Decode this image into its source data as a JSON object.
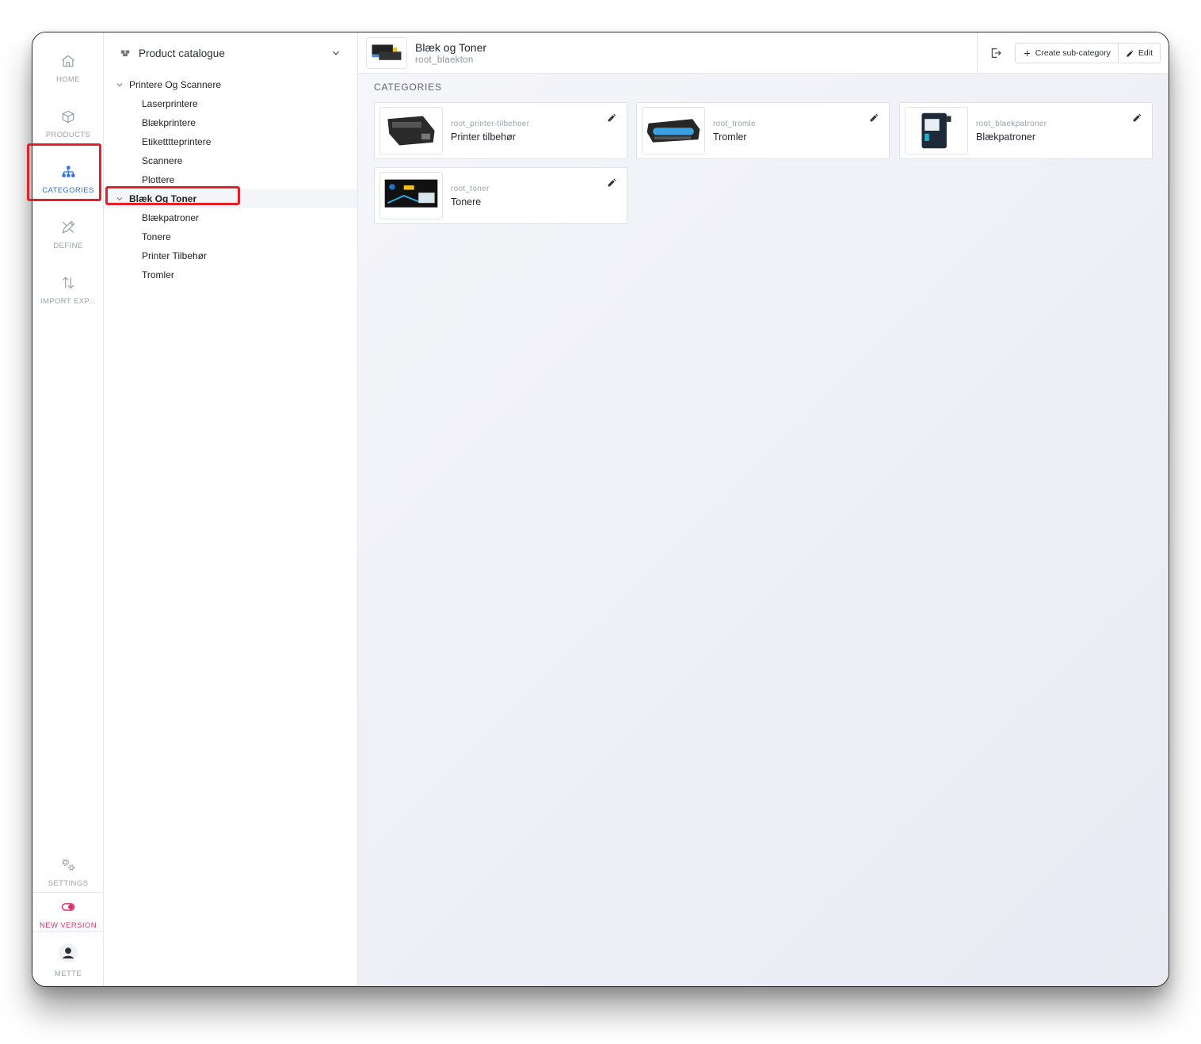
{
  "nav": {
    "home": "HOME",
    "products": "PRODUCTS",
    "categories": "CATEGORIES",
    "define": "DEFINE",
    "import_export": "IMPORT EXP...",
    "settings": "SETTINGS",
    "new_version": "NEW VERSION",
    "user": "METTE"
  },
  "tree": {
    "header": "Product catalogue",
    "groups": [
      {
        "label": "Printere Og Scannere",
        "children": [
          "Laserprintere",
          "Blækprintere",
          "Etiketttteprintere",
          "Scannere",
          "Plottere"
        ]
      },
      {
        "label": "Blæk Og Toner",
        "children": [
          "Blækpatroner",
          "Tonere",
          "Printer Tilbehør",
          "Tromler"
        ]
      }
    ]
  },
  "header": {
    "title": "Blæk og Toner",
    "code": "root_blaekton",
    "create_label": "Create sub-category",
    "edit_label": "Edit"
  },
  "section_title": "CATEGORIES",
  "cards": [
    {
      "code": "root_printer-tilbehoer",
      "name": "Printer tilbehør"
    },
    {
      "code": "root_tromle",
      "name": "Tromler"
    },
    {
      "code": "root_blaekpatroner",
      "name": "Blækpatroner"
    },
    {
      "code": "root_toner",
      "name": "Tonere"
    }
  ],
  "colors": {
    "accent": "#2f6fdb",
    "danger": "#e0306b",
    "highlight": "#e3202a"
  }
}
